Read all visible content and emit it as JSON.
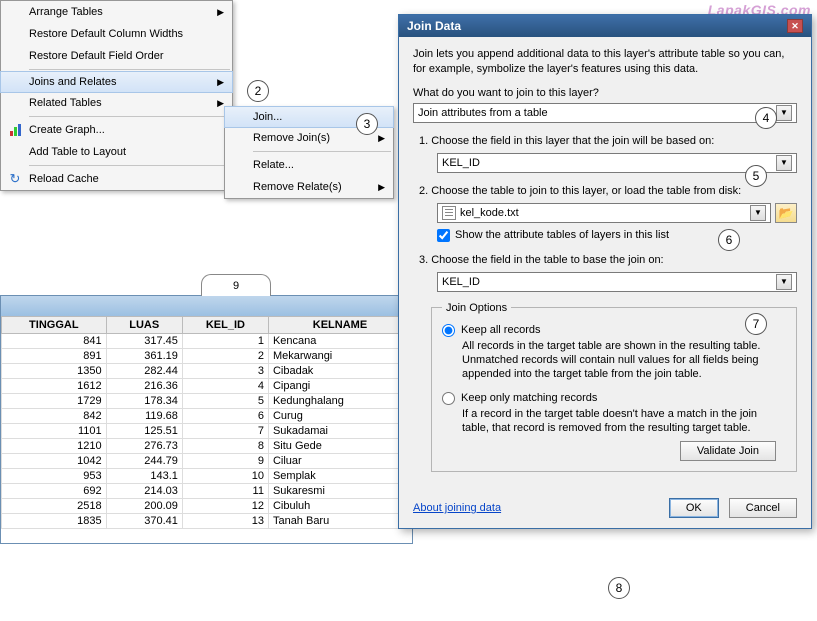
{
  "watermark": "LapakGIS.com",
  "menu": {
    "items": [
      "Arrange Tables",
      "Restore Default Column Widths",
      "Restore Default Field Order",
      "Joins and Relates",
      "Related Tables",
      "Create Graph...",
      "Add Table to Layout",
      "Reload Cache"
    ],
    "sub": [
      "Join...",
      "Remove Join(s)",
      "Relate...",
      "Remove Relate(s)"
    ]
  },
  "callouts": {
    "c2": "2",
    "c3": "3",
    "c4": "4",
    "c5": "5",
    "c6": "6",
    "c7": "7",
    "c8": "8",
    "c9": "9"
  },
  "table": {
    "headers": [
      "TINGGAL",
      "LUAS",
      "KEL_ID",
      "KELNAME"
    ],
    "rows": [
      [
        "841",
        "317.45",
        "1",
        "Kencana"
      ],
      [
        "891",
        "361.19",
        "2",
        "Mekarwangi"
      ],
      [
        "1350",
        "282.44",
        "3",
        "Cibadak"
      ],
      [
        "1612",
        "216.36",
        "4",
        "Cipangi"
      ],
      [
        "1729",
        "178.34",
        "5",
        "Kedunghalang"
      ],
      [
        "842",
        "119.68",
        "6",
        "Curug"
      ],
      [
        "1101",
        "125.51",
        "7",
        "Sukadamai"
      ],
      [
        "1210",
        "276.73",
        "8",
        "Situ Gede"
      ],
      [
        "1042",
        "244.79",
        "9",
        "Ciluar"
      ],
      [
        "953",
        "143.1",
        "10",
        "Semplak"
      ],
      [
        "692",
        "214.03",
        "11",
        "Sukaresmi"
      ],
      [
        "2518",
        "200.09",
        "12",
        "Cibuluh"
      ],
      [
        "1835",
        "370.41",
        "13",
        "Tanah Baru"
      ]
    ]
  },
  "dialog": {
    "title": "Join Data",
    "intro": "Join lets you append additional data to this layer's attribute table so you can, for example, symbolize the layer's features using this data.",
    "q": "What do you want to join to this layer?",
    "join_type": "Join attributes from a table",
    "s1_label": "1.  Choose the field in this layer that the join will be based on:",
    "s1_value": "KEL_ID",
    "s2_label": "2.  Choose the table to join to this layer, or load the table from disk:",
    "s2_value": "kel_kode.txt",
    "s2_check": "Show the attribute tables of layers in this list",
    "s3_label": "3.  Choose the field in the table to base the join on:",
    "s3_value": "KEL_ID",
    "opt_legend": "Join Options",
    "opt1": "Keep all records",
    "opt1_desc": "All records in the target table are shown in the resulting table. Unmatched records will contain null values for all fields being appended into the target table from the join table.",
    "opt2": "Keep only matching records",
    "opt2_desc": "If a record in the target table doesn't have a match in the join table, that record is removed from the resulting target table.",
    "validate": "Validate Join",
    "about": "About joining data",
    "ok": "OK",
    "cancel": "Cancel"
  }
}
